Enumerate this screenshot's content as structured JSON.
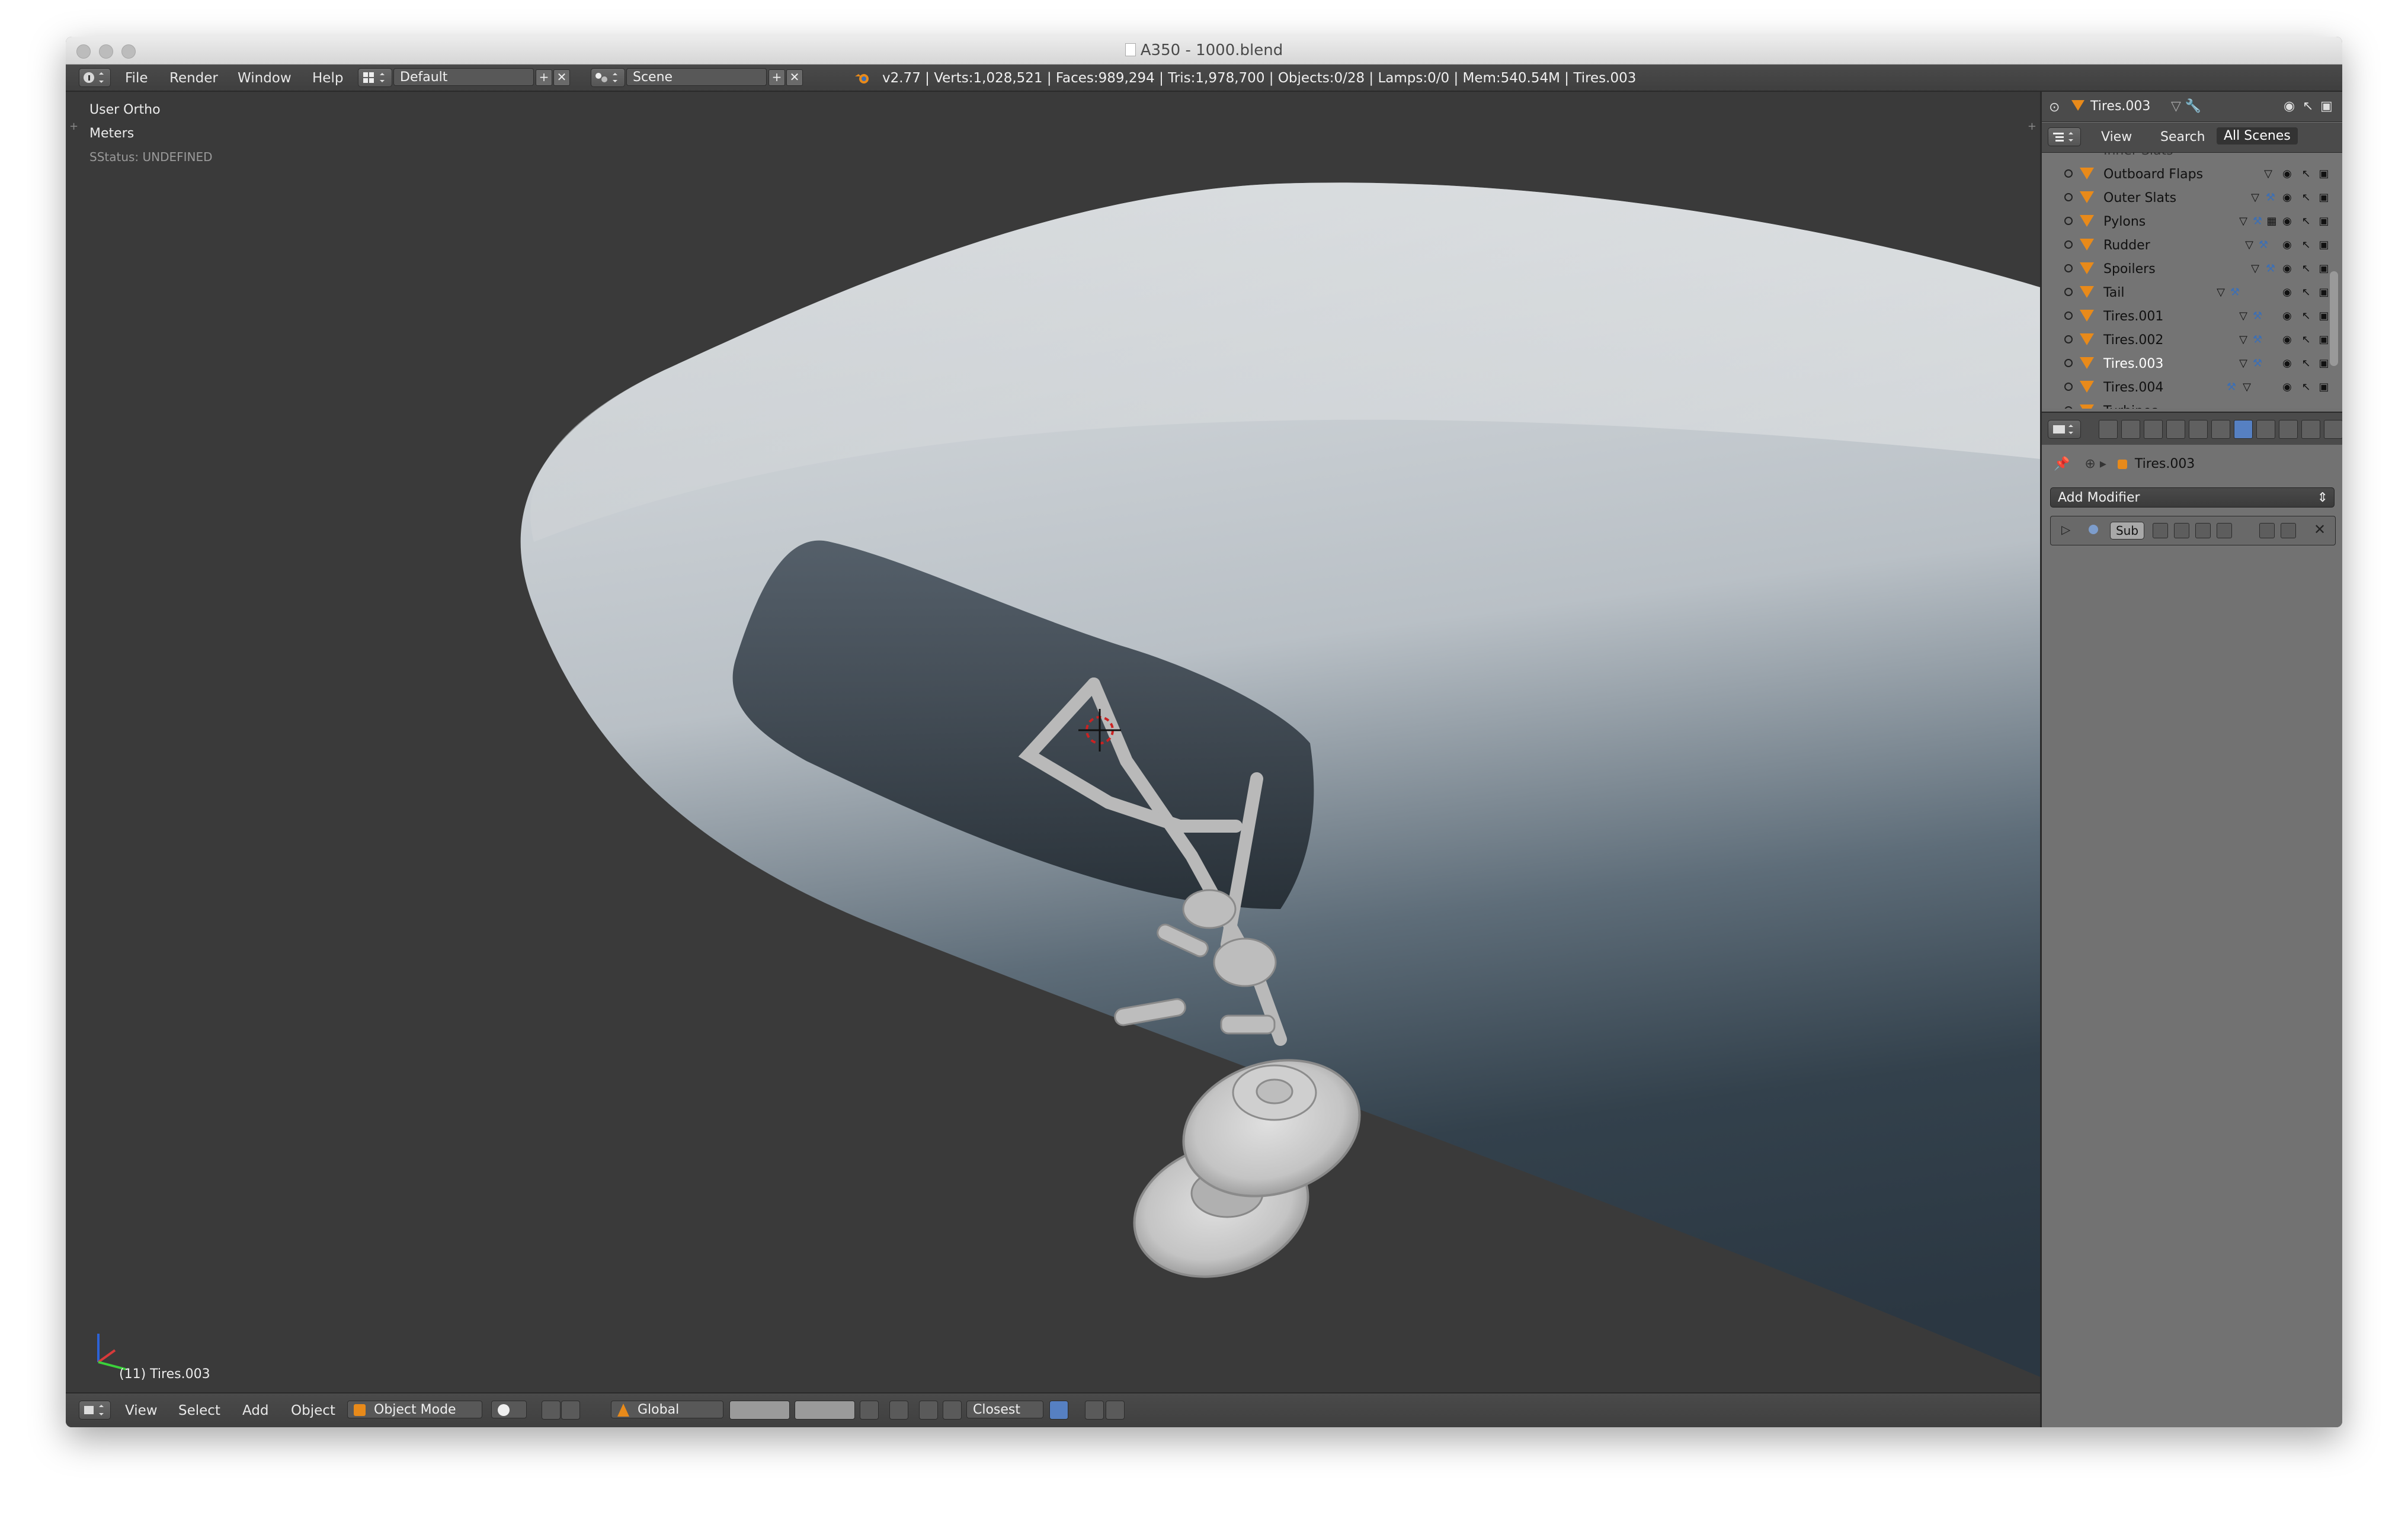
{
  "window": {
    "title": "A350 - 1000.blend"
  },
  "info_header": {
    "menus": [
      "File",
      "Render",
      "Window",
      "Help"
    ],
    "screen_layout": "Default",
    "scene": "Scene",
    "stats": "v2.77 | Verts:1,028,521 | Faces:989,294 | Tris:1,978,700 | Objects:0/28 | Lamps:0/0 | Mem:540.54M | Tires.003"
  },
  "viewport": {
    "view_name": "User Ortho",
    "units": "Meters",
    "status": "SStatus: UNDEFINED",
    "active_object_label": "(11) Tires.003"
  },
  "footer": {
    "menus": [
      "View",
      "Select",
      "Add",
      "Object"
    ],
    "mode": "Object Mode",
    "orientation": "Global",
    "snap_target": "Closest"
  },
  "outliner": {
    "header_object": "Tires.003",
    "tabs": [
      "View",
      "Search",
      "All Scenes"
    ],
    "partial_top_row": "Inner Slats",
    "rows": [
      {
        "name": "Outboard Flaps"
      },
      {
        "name": "Outer Slats"
      },
      {
        "name": "Pylons"
      },
      {
        "name": "Rudder"
      },
      {
        "name": "Spoilers"
      },
      {
        "name": "Tail"
      },
      {
        "name": "Tires.001"
      },
      {
        "name": "Tires.002"
      },
      {
        "name": "Tires.003",
        "selected": true
      },
      {
        "name": "Tires.004"
      }
    ],
    "partial_bottom_row": "Turbines"
  },
  "properties": {
    "context_object": "Tires.003",
    "add_modifier_label": "Add Modifier",
    "modifier_name": "Sub"
  },
  "colors": {
    "object_icon": "#e88a1a",
    "active_tab": "#5680c2",
    "viewport_bg": "#3a3a3a",
    "fuselage": "#c9ced3",
    "fuselage_shadow": "#2d3a45"
  }
}
